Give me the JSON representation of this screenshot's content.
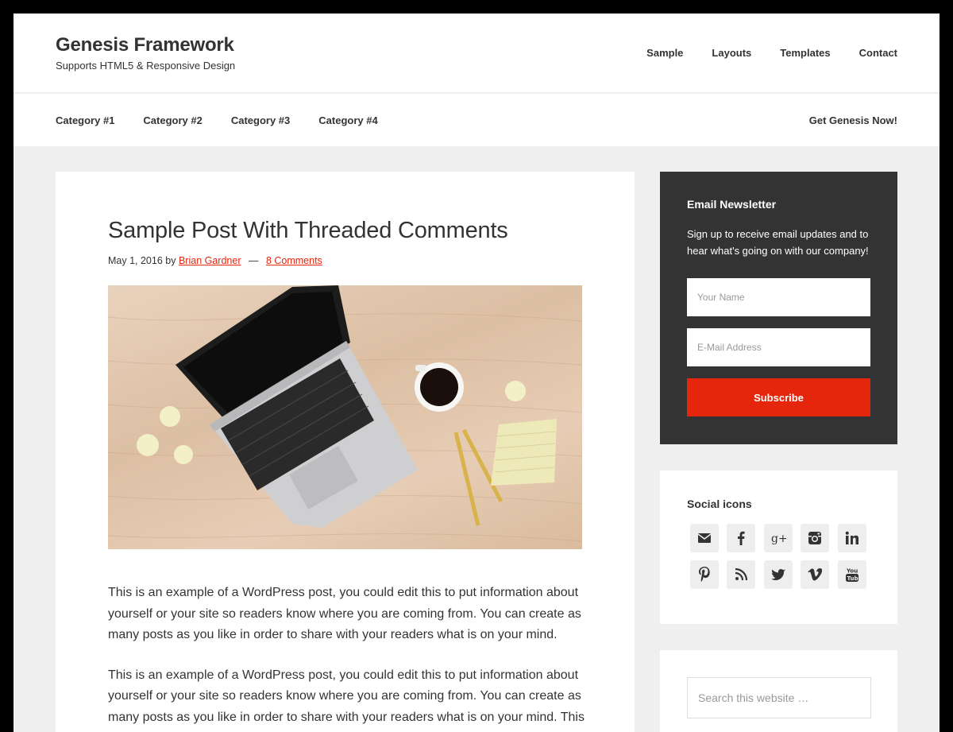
{
  "header": {
    "title": "Genesis Framework",
    "description": "Supports HTML5 & Responsive Design",
    "nav": [
      {
        "label": "Sample"
      },
      {
        "label": "Layouts"
      },
      {
        "label": "Templates"
      },
      {
        "label": "Contact"
      }
    ]
  },
  "secondary_nav": {
    "categories": [
      {
        "label": "Category #1"
      },
      {
        "label": "Category #2"
      },
      {
        "label": "Category #3"
      },
      {
        "label": "Category #4"
      }
    ],
    "cta": "Get Genesis Now!"
  },
  "post": {
    "title": "Sample Post With Threaded Comments",
    "date": "May 1, 2016",
    "by": "by",
    "author": "Brian Gardner",
    "separator": "—",
    "comments": "8 Comments",
    "paragraphs": [
      "This is an example of a WordPress post, you could edit this to put information about yourself or your site so readers know where you are coming from. You can create as many posts as you like in order to share with your readers what is on your mind.",
      "This is an example of a WordPress post, you could edit this to put information about yourself or your site so readers know where you are coming from. You can create as many posts as you like in order to share with your readers what is on your mind. This is"
    ]
  },
  "sidebar": {
    "newsletter": {
      "title": "Email Newsletter",
      "description": "Sign up to receive email updates and to hear what's going on with our company!",
      "name_placeholder": "Your Name",
      "email_placeholder": "E-Mail Address",
      "submit_label": "Subscribe"
    },
    "social": {
      "title": "Social icons",
      "icons": [
        "email-icon",
        "facebook-icon",
        "google-plus-icon",
        "instagram-icon",
        "linkedin-icon",
        "pinterest-icon",
        "rss-icon",
        "twitter-icon",
        "vimeo-icon",
        "youtube-icon"
      ]
    },
    "search": {
      "placeholder": "Search this website …"
    }
  },
  "colors": {
    "accent": "#e5250c",
    "dark_widget": "#333333",
    "page_bg": "#efefef"
  }
}
